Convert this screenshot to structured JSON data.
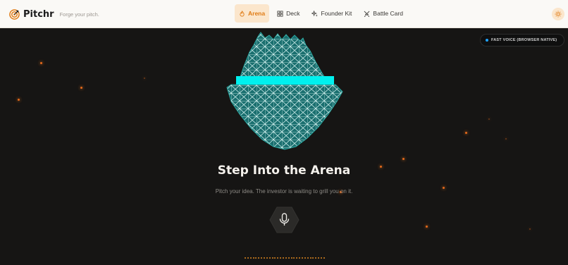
{
  "brand": {
    "name": "Pitchr",
    "tagline": "Forge your pitch.",
    "icon": "target-icon",
    "accent": "#e07b14"
  },
  "nav": {
    "tabs": [
      {
        "label": "Arena",
        "icon": "flame-icon",
        "active": true
      },
      {
        "label": "Deck",
        "icon": "grid-icon",
        "active": false
      },
      {
        "label": "Founder Kit",
        "icon": "sparkles-icon",
        "active": false
      },
      {
        "label": "Battle Card",
        "icon": "swords-icon",
        "active": false
      }
    ]
  },
  "theme_toggle": {
    "icon": "sun-icon"
  },
  "voice_badge": {
    "label": "FAST VOICE (BROWSER NATIVE)",
    "dot_color": "#1fa3ff"
  },
  "hero": {
    "title": "Step Into the Arena",
    "subtitle": "Pitch your idea. The investor is waiting to grill you on it.",
    "avatar_icon": "wireframe-investor-avatar",
    "mic_icon": "microphone-icon"
  },
  "colors": {
    "background": "#161514",
    "mesh": "#1e7f7f",
    "visor": "#00f0ee",
    "ember": "#e5691b"
  }
}
